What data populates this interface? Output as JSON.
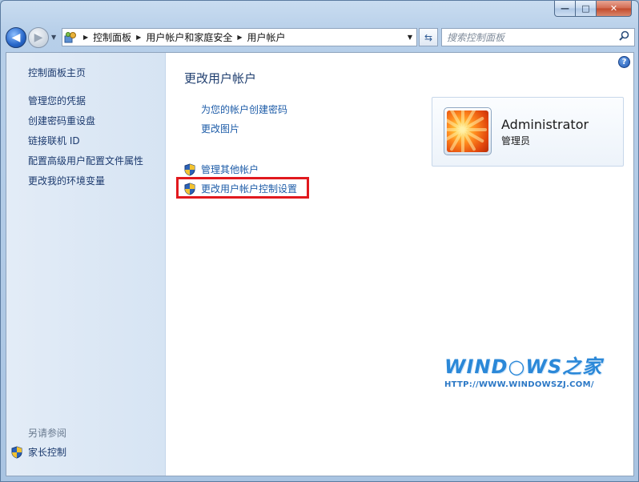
{
  "window": {
    "minimize_label": "—",
    "maximize_label": "□",
    "close_label": "✕"
  },
  "nav": {
    "back_icon": "back-arrow-icon",
    "forward_icon": "forward-arrow-icon",
    "breadcrumbs": [
      "控制面板",
      "用户帐户和家庭安全",
      "用户帐户"
    ],
    "search_placeholder": "搜索控制面板"
  },
  "sidebar": {
    "items": [
      {
        "label": "控制面板主页"
      },
      {
        "label": "管理您的凭据"
      },
      {
        "label": "创建密码重设盘"
      },
      {
        "label": "链接联机 ID"
      },
      {
        "label": "配置高级用户配置文件属性"
      },
      {
        "label": "更改我的环境变量"
      }
    ],
    "see_also_label": "另请参阅",
    "see_also_items": [
      {
        "label": "家长控制"
      }
    ]
  },
  "main": {
    "title": "更改用户帐户",
    "tasks": [
      {
        "label": "为您的帐户创建密码",
        "shield": false
      },
      {
        "label": "更改图片",
        "shield": false
      },
      {
        "label": "管理其他帐户",
        "shield": true
      },
      {
        "label": "更改用户帐户控制设置",
        "shield": true,
        "highlighted": true
      }
    ],
    "account": {
      "name": "Administrator",
      "role": "管理员"
    },
    "help_label": "?"
  },
  "watermark": {
    "logo": "WIND○WS之家",
    "url": "HTTP://WWW.WINDOWSZJ.COM/"
  },
  "colors": {
    "link": "#1e5ca8",
    "sidebar_link": "#1c3a6e",
    "highlight": "#e1191e",
    "watermark": "#2b88d8"
  }
}
